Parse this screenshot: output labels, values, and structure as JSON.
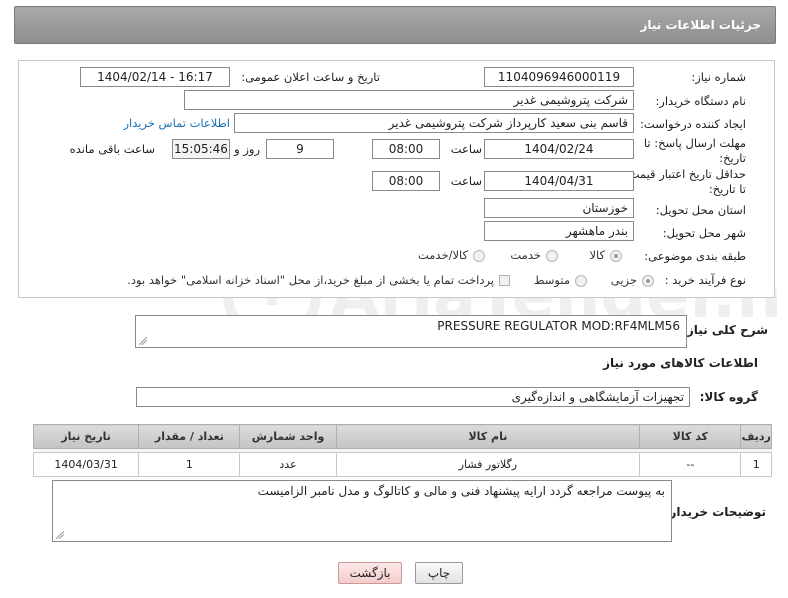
{
  "header": {
    "title": "جزئیات اطلاعات نیاز"
  },
  "form": {
    "need_number": {
      "label": "شماره نیاز:",
      "value": "1104096946000119"
    },
    "announce_datetime": {
      "label": "تاریخ و ساعت اعلان عمومی:",
      "value": "1404/02/14 - 16:17"
    },
    "buyer_org": {
      "label": "نام دستگاه خریدار:",
      "value": "شرکت پتروشیمی غدیر"
    },
    "creator": {
      "label": "ایجاد کننده درخواست:",
      "value": "قاسم بنی سعید کارپرداز شرکت پتروشیمی غدیر",
      "contact_link": "اطلاعات تماس خریدار"
    },
    "reply_deadline": {
      "label_line1": "مهلت ارسال پاسخ: تا",
      "label_line2": "تاریخ:",
      "date": "1404/02/24",
      "time_label": "ساعت",
      "time": "08:00",
      "days": "9",
      "days_label": "روز و",
      "remaining": "15:05:46",
      "remaining_label": "ساعت باقی مانده"
    },
    "price_validity": {
      "label_line1": "حداقل تاریخ اعتبار قیمت:",
      "label_line2": "تا تاریخ:",
      "date": "1404/04/31",
      "time_label": "ساعت",
      "time": "08:00"
    },
    "province": {
      "label": "استان محل تحویل:",
      "value": "خوزستان"
    },
    "city": {
      "label": "شهر محل تحویل:",
      "value": "بندر ماهشهر"
    },
    "category": {
      "label": "طبقه بندی موضوعی:",
      "options": [
        "کالا",
        "خدمت",
        "کالا/خدمت"
      ],
      "selected": "کالا"
    },
    "process_type": {
      "label": "نوع فرآیند خرید :",
      "options": [
        "جزیی",
        "متوسط"
      ],
      "selected": "جزیی",
      "payment_note": "پرداخت تمام یا بخشی از مبلغ خرید،از محل \"اسناد خزانه اسلامی\" خواهد بود."
    }
  },
  "description": {
    "label": "شرح کلی نیاز:",
    "value": "PRESSURE REGULATOR MOD:RF4MLM56"
  },
  "items_section": {
    "title": "اطلاعات کالاهای مورد نیاز",
    "group_label": "گروه کالا:",
    "group_value": "تجهیزات آزمایشگاهی و اندازه‌گیری",
    "columns": [
      "ردیف",
      "کد کالا",
      "نام کالا",
      "واحد شمارش",
      "تعداد / مقدار",
      "تاریخ نیاز"
    ],
    "rows": [
      {
        "row": "1",
        "code": "--",
        "name": "رگلاتور فشار",
        "unit": "عدد",
        "qty": "1",
        "date": "1404/03/31"
      }
    ]
  },
  "buyer_notes": {
    "label": "توضیحات خریدار:",
    "value": "به پیوست مراجعه گردد ارایه پیشنهاد فنی و مالی و کاتالوگ و مدل نامبر الزامیست"
  },
  "buttons": {
    "print": "چاپ",
    "back": "بازگشت"
  },
  "watermark": {
    "text": "AriaTender.neT"
  },
  "colors": {
    "header": "#9a9a9a",
    "link": "#1a6fb4",
    "back_button": "#f4cccc"
  }
}
